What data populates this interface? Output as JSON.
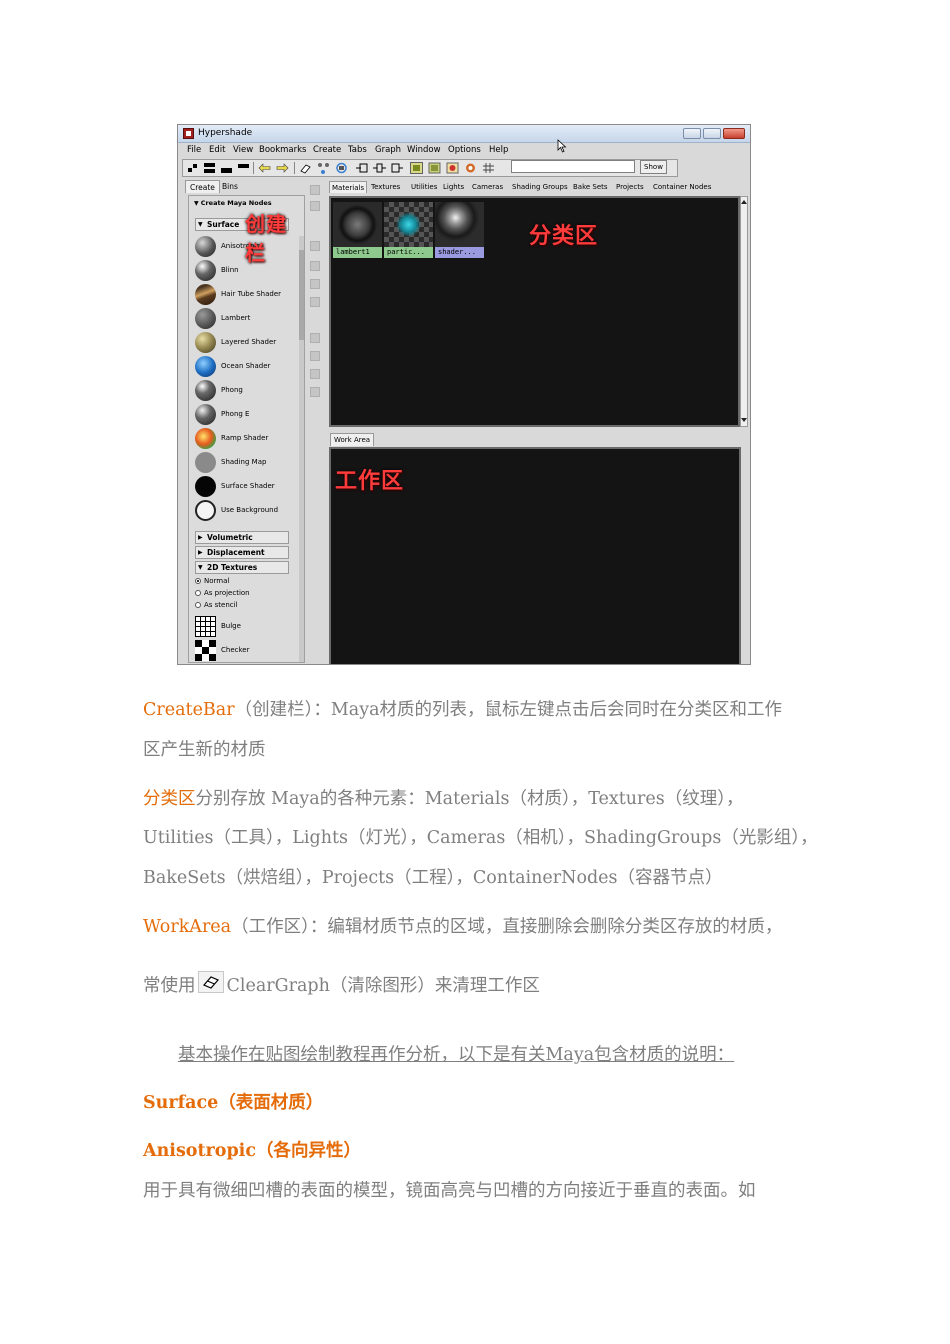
{
  "window": {
    "title": "Hypershade",
    "menus": [
      "File",
      "Edit",
      "View",
      "Bookmarks",
      "Create",
      "Tabs",
      "Graph",
      "Window",
      "Options",
      "Help"
    ],
    "show_label": "Show",
    "search_value": ""
  },
  "create_bar": {
    "tabs": [
      "Create",
      "Bins"
    ],
    "header": "Create Maya Nodes",
    "surface_label": "Surface",
    "surface_nodes": [
      "Anisotropic",
      "Blinn",
      "Hair Tube Shader",
      "Lambert",
      "Layered Shader",
      "Ocean Shader",
      "Phong",
      "Phong E",
      "Ramp Shader",
      "Shading Map",
      "Surface Shader",
      "Use Background"
    ],
    "sections": [
      "Volumetric",
      "Displacement",
      "2D Textures"
    ],
    "radio_options": [
      "Normal",
      "As projection",
      "As stencil"
    ],
    "texture_nodes": [
      "Bulge",
      "Checker"
    ]
  },
  "category": {
    "tabs": [
      "Materials",
      "Textures",
      "Utilities",
      "Lights",
      "Cameras",
      "Shading Groups",
      "Bake Sets",
      "Projects",
      "Container Nodes"
    ],
    "swatches": [
      "lambert1",
      "partic...",
      "shader..."
    ]
  },
  "work_area": {
    "tab": "Work Area"
  },
  "overlays": {
    "create_bar": "创建栏",
    "category": "分类区",
    "work_area": "工作区"
  },
  "colors": {
    "accent_orange": "#e46c0a",
    "body_gray": "#7f7f7f",
    "overlay_red": "#ff3b3b"
  },
  "text": {
    "p1_key": "CreateBar",
    "p1_rest_line1": "（创建栏）：Maya材质的列表，鼠标左键点击后会同时在分类区和工作",
    "p1_line2": "区产生新的材质",
    "p2_key": "分类区",
    "p2_rest_line1": "分别存放 Maya的各种元素：Materials（材质），Textures（纹理），",
    "p2_line2": "Utilities（工具），Lights（灯光），Cameras（相机），ShadingGroups（光影组），",
    "p2_line3": "BakeSets（烘焙组），Projects（工程），ContainerNodes（容器节点）",
    "p3_key": "WorkArea",
    "p3_rest_line1": "（工作区）：编辑材质节点的区域，直接删除会删除分类区存放的材质，",
    "p3_line2_pre": "常使用",
    "p3_line2_post": "ClearGraph（清除图形）来清理工作区",
    "p4": "基本操作在贴图绘制教程再作分析，以下是有关Maya包含材质的说明：",
    "h1": "Surface（表面材质）",
    "h2": "Anisotropic（各向异性）",
    "p5": "用于具有微细凹槽的表面的模型，镜面高亮与凹槽的方向接近于垂直的表面。如"
  }
}
